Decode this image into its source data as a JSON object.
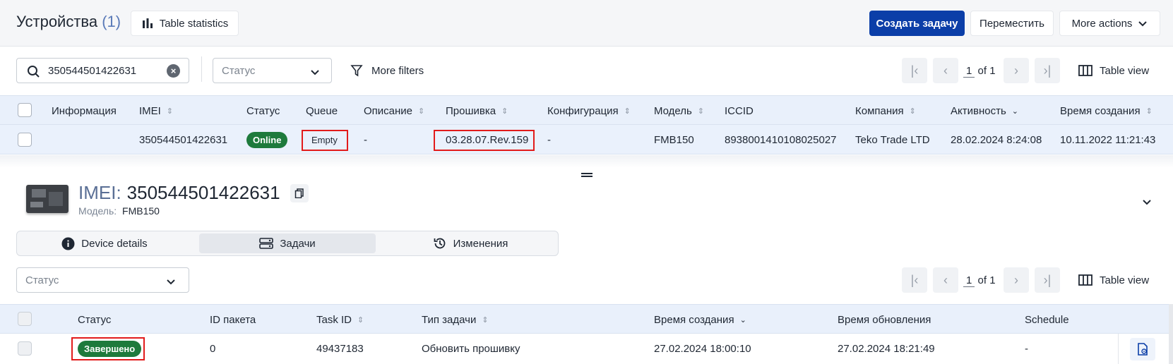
{
  "header": {
    "title": "Устройства",
    "count": "(1)",
    "table_statistics": "Table statistics",
    "create_task": "Создать задачу",
    "move": "Переместить",
    "more_actions": "More actions"
  },
  "filters": {
    "search_value": "350544501422631",
    "status_placeholder": "Статус",
    "more_filters": "More filters",
    "page": "1",
    "of": "of 1",
    "table_view": "Table view"
  },
  "devices_table": {
    "columns": [
      "Информация",
      "IMEI",
      "Статус",
      "Queue",
      "Описание",
      "Прошивка",
      "Конфигурация",
      "Модель",
      "ICCID",
      "Компания",
      "Активность",
      "Время создания"
    ],
    "row": {
      "info": "",
      "imei": "350544501422631",
      "status": "Online",
      "queue": "Empty",
      "description": "-",
      "firmware": "03.28.07.Rev.159",
      "config": "-",
      "model": "FMB150",
      "iccid": "8938001410108025027",
      "company": "Teko Trade LTD",
      "activity": "28.02.2024 8:24:08",
      "created": "10.11.2022 11:21:43"
    }
  },
  "device_panel": {
    "imei_label": "IMEI:",
    "imei_value": "350544501422631",
    "model_label": "Модель:",
    "model_value": "FMB150",
    "tabs": [
      "Device details",
      "Задачи",
      "Изменения"
    ],
    "active_tab": "Задачи",
    "status_placeholder": "Статус",
    "page": "1",
    "of": "of 1",
    "table_view": "Table view"
  },
  "tasks_table": {
    "columns": [
      "Статус",
      "ID пакета",
      "Task ID",
      "Тип задачи",
      "Время создания",
      "Время обновления",
      "Schedule"
    ],
    "row": {
      "status": "Завершено",
      "package_id": "0",
      "task_id": "49437183",
      "type": "Обновить прошивку",
      "created": "27.02.2024 18:00:10",
      "updated": "27.02.2024 18:21:49",
      "schedule": "-"
    }
  }
}
